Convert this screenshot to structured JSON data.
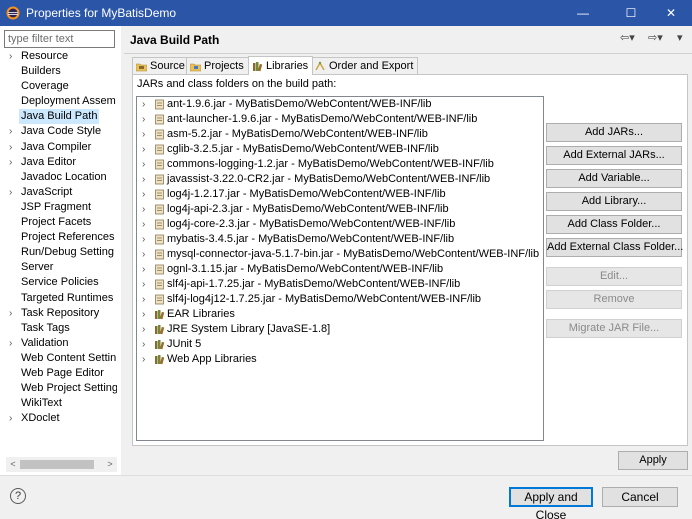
{
  "window": {
    "title": "Properties for MyBatisDemo",
    "minimize": "—",
    "maximize": "☐",
    "close": "✕"
  },
  "filter": {
    "placeholder": "type filter text",
    "value": ""
  },
  "nav": {
    "items": [
      {
        "label": "Resource",
        "arrow": "›"
      },
      {
        "label": "Builders",
        "arrow": ""
      },
      {
        "label": "Coverage",
        "arrow": ""
      },
      {
        "label": "Deployment Assem",
        "arrow": ""
      },
      {
        "label": "Java Build Path",
        "arrow": "",
        "selected": true
      },
      {
        "label": "Java Code Style",
        "arrow": "›"
      },
      {
        "label": "Java Compiler",
        "arrow": "›"
      },
      {
        "label": "Java Editor",
        "arrow": "›"
      },
      {
        "label": "Javadoc Location",
        "arrow": ""
      },
      {
        "label": "JavaScript",
        "arrow": "›"
      },
      {
        "label": "JSP Fragment",
        "arrow": ""
      },
      {
        "label": "Project Facets",
        "arrow": ""
      },
      {
        "label": "Project References",
        "arrow": ""
      },
      {
        "label": "Run/Debug Setting",
        "arrow": ""
      },
      {
        "label": "Server",
        "arrow": ""
      },
      {
        "label": "Service Policies",
        "arrow": ""
      },
      {
        "label": "Targeted Runtimes",
        "arrow": ""
      },
      {
        "label": "Task Repository",
        "arrow": "›"
      },
      {
        "label": "Task Tags",
        "arrow": ""
      },
      {
        "label": "Validation",
        "arrow": "›"
      },
      {
        "label": "Web Content Settin",
        "arrow": ""
      },
      {
        "label": "Web Page Editor",
        "arrow": ""
      },
      {
        "label": "Web Project Setting",
        "arrow": ""
      },
      {
        "label": "WikiText",
        "arrow": ""
      },
      {
        "label": "XDoclet",
        "arrow": "›"
      }
    ],
    "scroll_left": "<",
    "scroll_right": ">"
  },
  "page": {
    "title": "Java Build Path",
    "back": "⇦▾",
    "forward": "⇨▾",
    "menu": "▾"
  },
  "tabs": [
    {
      "label": "Source",
      "icon": "source-folder-icon"
    },
    {
      "label": "Projects",
      "icon": "projects-icon"
    },
    {
      "label": "Libraries",
      "icon": "libraries-icon",
      "active": true
    },
    {
      "label": "Order and Export",
      "icon": "order-export-icon"
    }
  ],
  "libraries": {
    "heading": "JARs and class folders on the build path:",
    "entries": [
      {
        "label": "ant-1.9.6.jar - MyBatisDemo/WebContent/WEB-INF/lib",
        "icon": "jar-icon"
      },
      {
        "label": "ant-launcher-1.9.6.jar - MyBatisDemo/WebContent/WEB-INF/lib",
        "icon": "jar-icon"
      },
      {
        "label": "asm-5.2.jar - MyBatisDemo/WebContent/WEB-INF/lib",
        "icon": "jar-icon"
      },
      {
        "label": "cglib-3.2.5.jar - MyBatisDemo/WebContent/WEB-INF/lib",
        "icon": "jar-icon"
      },
      {
        "label": "commons-logging-1.2.jar - MyBatisDemo/WebContent/WEB-INF/lib",
        "icon": "jar-icon"
      },
      {
        "label": "javassist-3.22.0-CR2.jar - MyBatisDemo/WebContent/WEB-INF/lib",
        "icon": "jar-icon"
      },
      {
        "label": "log4j-1.2.17.jar - MyBatisDemo/WebContent/WEB-INF/lib",
        "icon": "jar-icon"
      },
      {
        "label": "log4j-api-2.3.jar - MyBatisDemo/WebContent/WEB-INF/lib",
        "icon": "jar-icon"
      },
      {
        "label": "log4j-core-2.3.jar - MyBatisDemo/WebContent/WEB-INF/lib",
        "icon": "jar-icon"
      },
      {
        "label": "mybatis-3.4.5.jar - MyBatisDemo/WebContent/WEB-INF/lib",
        "icon": "jar-icon"
      },
      {
        "label": "mysql-connector-java-5.1.7-bin.jar - MyBatisDemo/WebContent/WEB-INF/lib",
        "icon": "jar-icon"
      },
      {
        "label": "ognl-3.1.15.jar - MyBatisDemo/WebContent/WEB-INF/lib",
        "icon": "jar-icon"
      },
      {
        "label": "slf4j-api-1.7.25.jar - MyBatisDemo/WebContent/WEB-INF/lib",
        "icon": "jar-icon"
      },
      {
        "label": "slf4j-log4j12-1.7.25.jar - MyBatisDemo/WebContent/WEB-INF/lib",
        "icon": "jar-icon"
      },
      {
        "label": "EAR Libraries",
        "icon": "library-icon"
      },
      {
        "label": "JRE System Library [JavaSE-1.8]",
        "icon": "library-icon"
      },
      {
        "label": "JUnit 5",
        "icon": "library-icon"
      },
      {
        "label": "Web App Libraries",
        "icon": "library-icon"
      }
    ],
    "expander": "›"
  },
  "buttons": {
    "add_jars": "Add JARs...",
    "add_external_jars": "Add External JARs...",
    "add_variable": "Add Variable...",
    "add_library": "Add Library...",
    "add_class_folder": "Add Class Folder...",
    "add_external_class_folder": "Add External Class Folder...",
    "edit": "Edit...",
    "remove": "Remove",
    "migrate_jar": "Migrate JAR File...",
    "apply": "Apply",
    "apply_and_close": "Apply and Close",
    "cancel": "Cancel",
    "help": "?"
  },
  "colors": {
    "titlebar": "#2b56a8",
    "selection": "#cce8ff",
    "default_button_border": "#0078d7"
  }
}
